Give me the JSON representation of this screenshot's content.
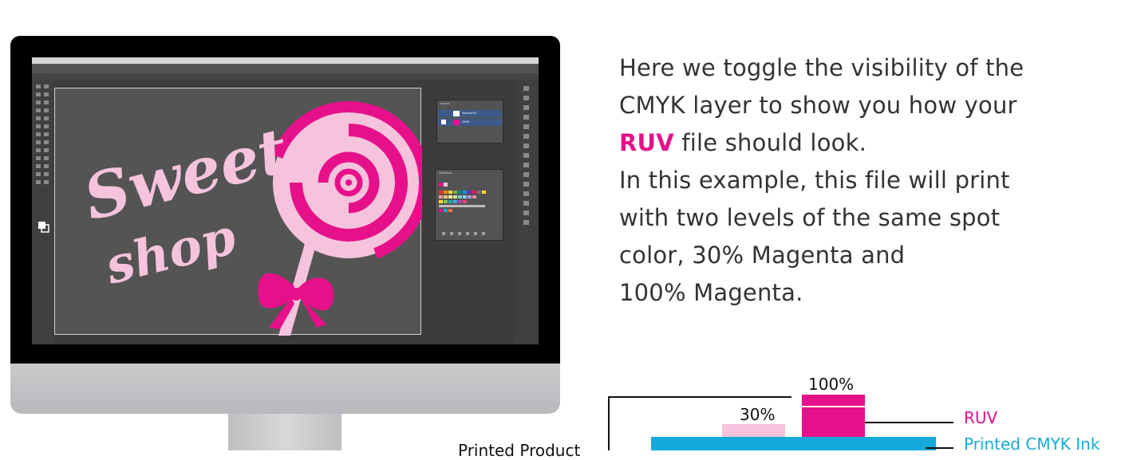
{
  "screen": {
    "title_artwork": {
      "word1": "Sweet",
      "word2": "shop"
    },
    "layers_panel": {
      "title": "Layers",
      "rows": [
        "Varnish/UV",
        "CMYK"
      ]
    },
    "swatches_panel": {
      "title": "Swatches"
    }
  },
  "description": {
    "line1": "Here we toggle the visibility of the",
    "line2": "CMYK layer to show you how  your",
    "line3_em": "RUV",
    "line3_rest": " file should look.",
    "line4": "In this example, this file will print",
    "line5": "with two levels of the same spot",
    "line6": "color, 30% Magenta and",
    "line7": "100% Magenta."
  },
  "diagram": {
    "label_100": "100%",
    "label_30": "30%",
    "label_ruv": "RUV",
    "label_cmyk": "Printed CMYK Ink",
    "label_product": "Printed Product"
  },
  "colors": {
    "magenta": "#e6118a",
    "light_pink": "#f5c3dc",
    "cyan": "#16aadb",
    "text": "#333333"
  }
}
